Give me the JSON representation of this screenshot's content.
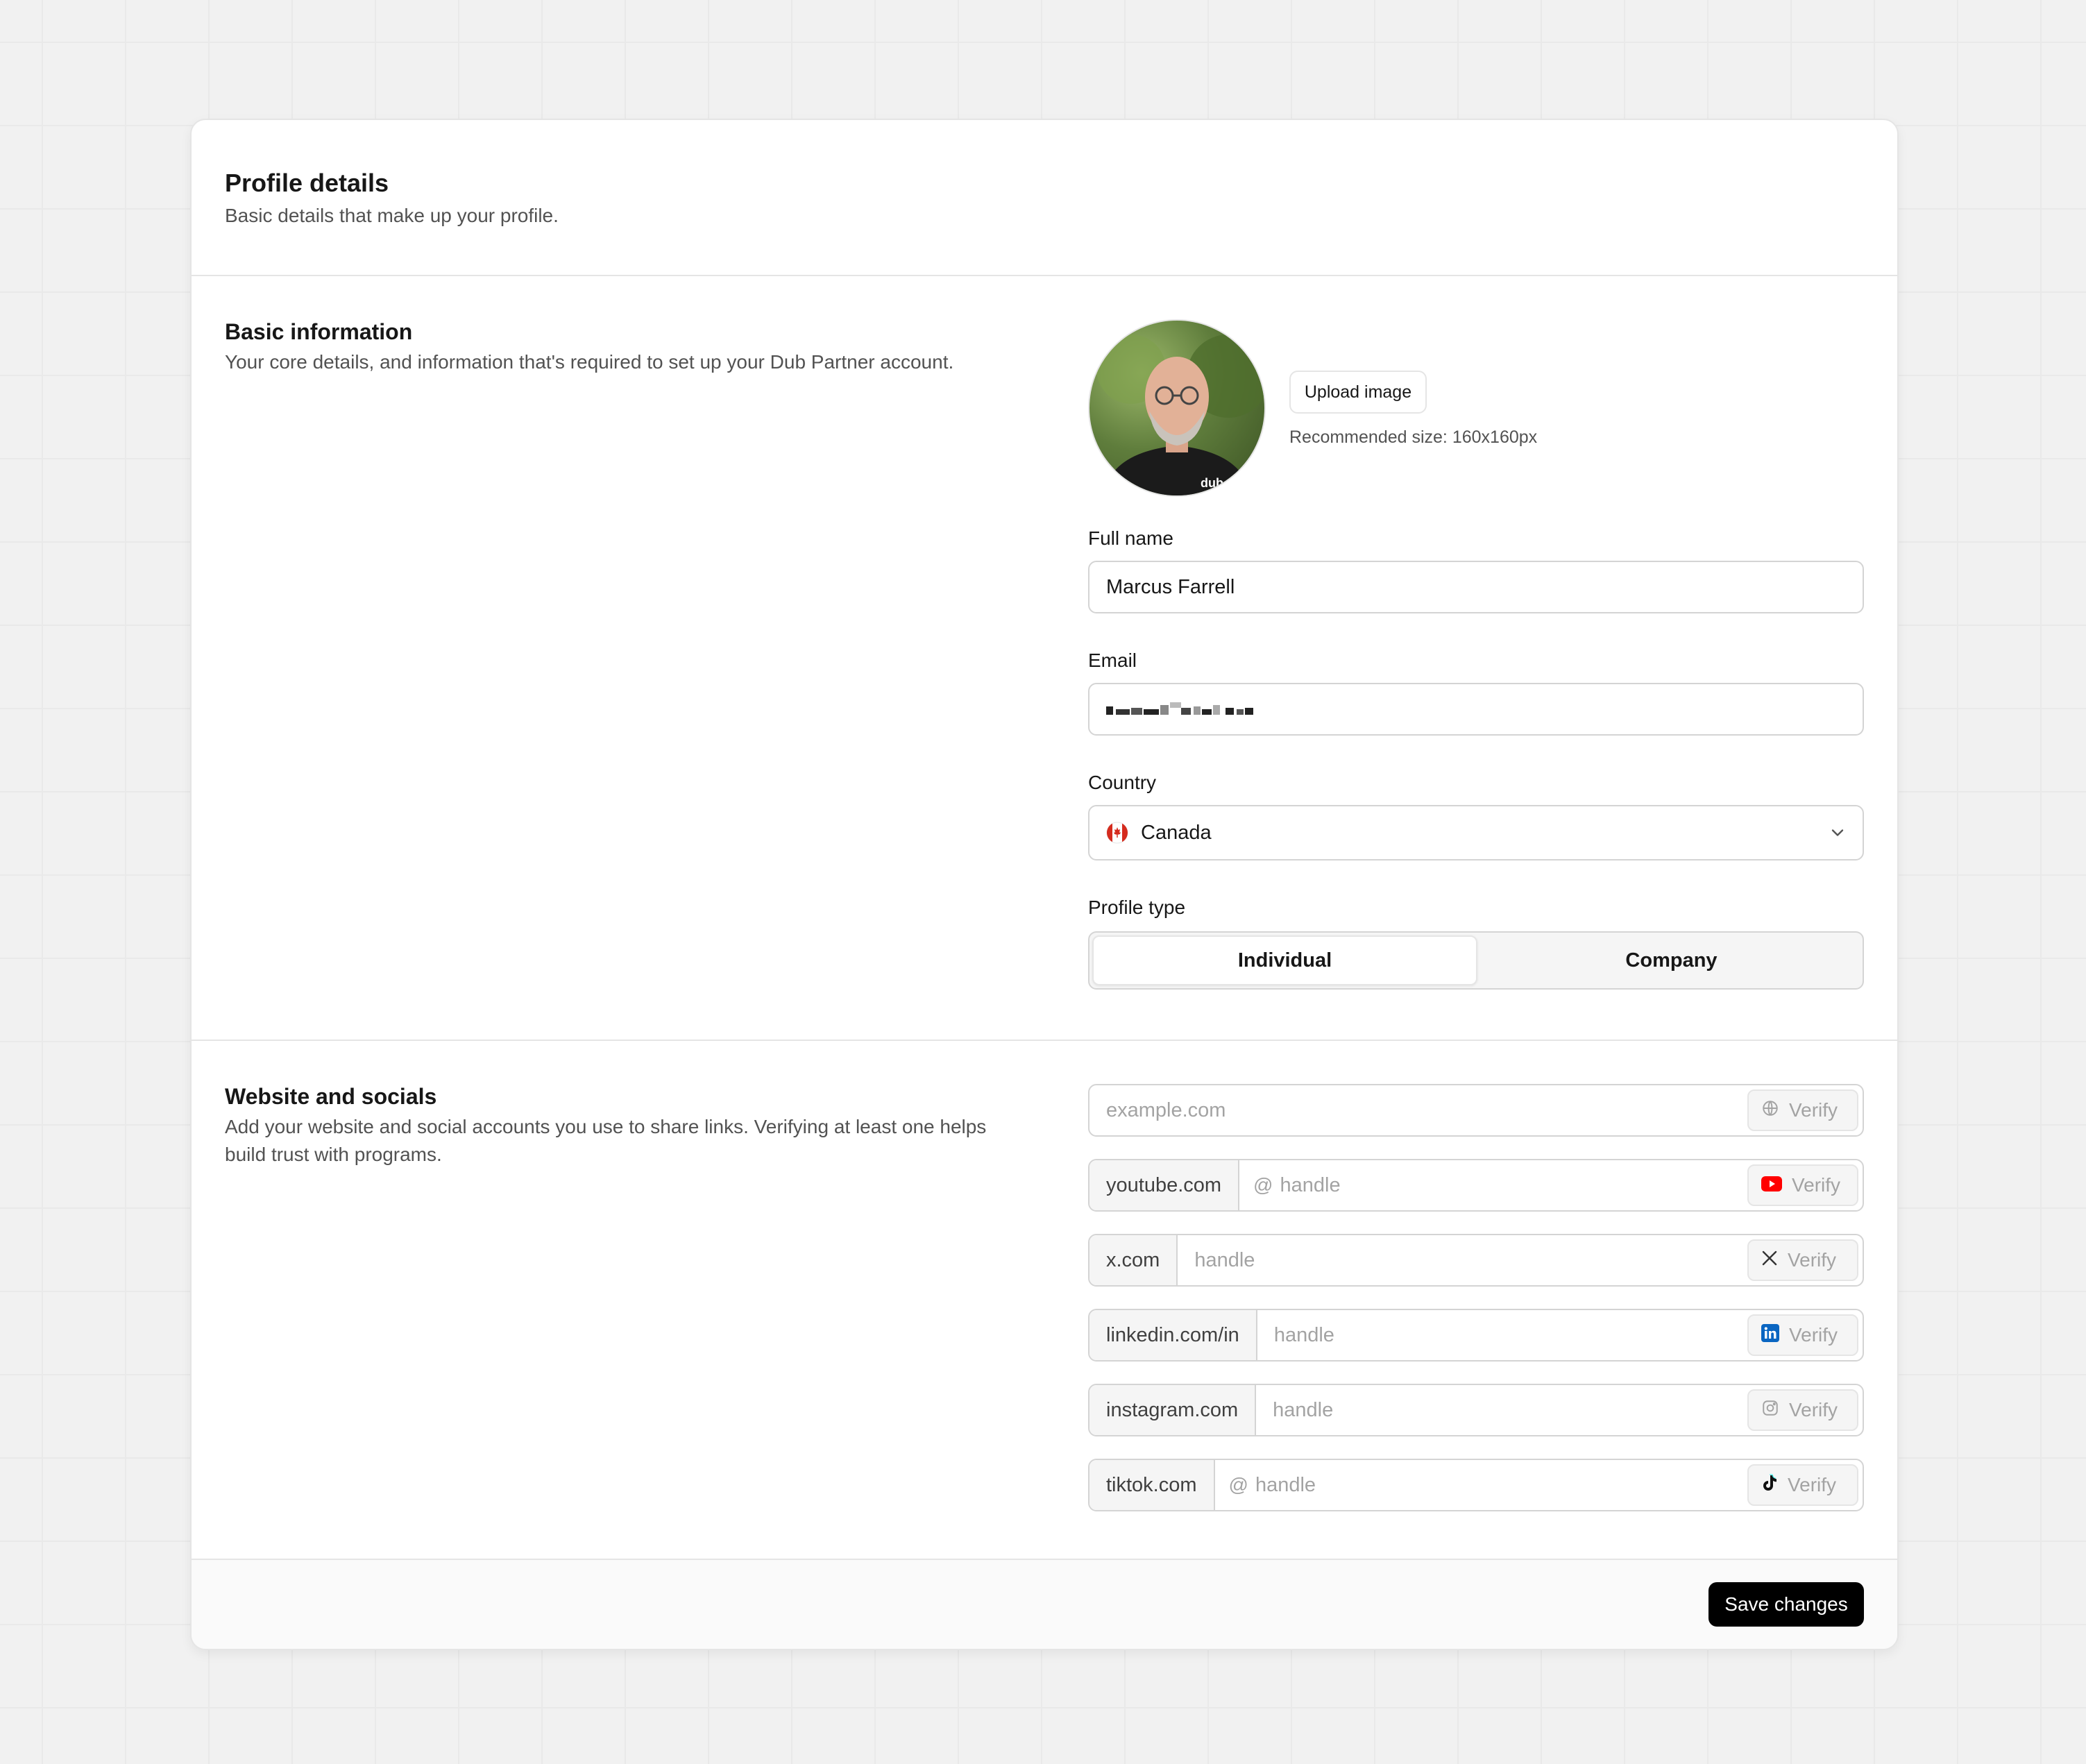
{
  "header": {
    "title": "Profile details",
    "description": "Basic details that make up your profile."
  },
  "basic": {
    "title": "Basic information",
    "description": "Your core details, and information that's required to set up your Dub Partner account.",
    "upload_label": "Upload image",
    "upload_hint": "Recommended size: 160x160px",
    "full_name_label": "Full name",
    "full_name_value": "Marcus Farrell",
    "email_label": "Email",
    "email_value": "",
    "country_label": "Country",
    "country_value": "Canada",
    "profile_type_label": "Profile type",
    "profile_type_options": [
      "Individual",
      "Company"
    ],
    "profile_type_selected": "Individual"
  },
  "socials": {
    "title": "Website and socials",
    "description": "Add your website and social accounts you use to share links. Verifying at least one helps build trust with programs.",
    "website_placeholder": "example.com",
    "verify_label": "Verify",
    "at_symbol": "@",
    "rows": [
      {
        "prefix": "youtube.com",
        "placeholder": "handle",
        "icon": "youtube-icon"
      },
      {
        "prefix": "x.com",
        "placeholder": "handle",
        "icon": "x-icon"
      },
      {
        "prefix": "linkedin.com/in",
        "placeholder": "handle",
        "icon": "linkedin-icon"
      },
      {
        "prefix": "instagram.com",
        "placeholder": "handle",
        "icon": "instagram-icon"
      },
      {
        "prefix": "tiktok.com",
        "placeholder": "handle",
        "icon": "tiktok-icon"
      }
    ]
  },
  "footer": {
    "save_label": "Save changes"
  },
  "colors": {
    "youtube": "#ff0000",
    "linkedin": "#0a66c2",
    "primary_button": "#000000"
  }
}
